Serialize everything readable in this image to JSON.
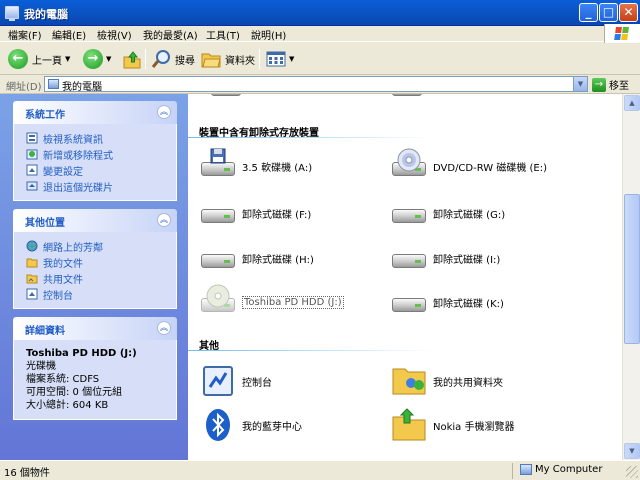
{
  "window": {
    "title": "我的電腦"
  },
  "menu": {
    "items": [
      "檔案(F)",
      "編輯(E)",
      "檢視(V)",
      "我的最愛(A)",
      "工具(T)",
      "說明(H)"
    ]
  },
  "toolbar": {
    "back_label": "上一頁",
    "search_label": "搜尋",
    "folders_label": "資料夾"
  },
  "address": {
    "label": "網址(D)",
    "value": "我的電腦",
    "go_label": "移至"
  },
  "system_tasks": {
    "title": "系統工作",
    "items": [
      "檢視系統資訊",
      "新增或移除程式",
      "變更設定",
      "退出這個光碟片"
    ]
  },
  "other_places": {
    "title": "其他位置",
    "items": [
      "網路上的芳鄰",
      "我的文件",
      "共用文件",
      "控制台"
    ]
  },
  "details": {
    "title": "詳細資料",
    "name": "Toshiba PD HDD (J:)",
    "type": "光碟機",
    "filesystem": "檔案系統: CDFS",
    "free": "可用空間: 0 個位元組",
    "total": "大小總計: 604 KB"
  },
  "removable": {
    "header": "裝置中含有卸除式存放裝置",
    "items": [
      "3.5 軟碟機 (A:)",
      "DVD/CD-RW 磁碟機 (E:)",
      "卸除式磁碟 (F:)",
      "卸除式磁碟 (G:)",
      "卸除式磁碟 (H:)",
      "卸除式磁碟 (I:)",
      "Toshiba PD HDD (J:)",
      "卸除式磁碟 (K:)"
    ]
  },
  "other": {
    "header": "其他",
    "items": [
      "控制台",
      "我的共用資料夾",
      "我的藍芽中心",
      "Nokia 手機瀏覽器"
    ]
  },
  "status": {
    "count": "16 個物件",
    "location": "My Computer"
  },
  "colors": {
    "title_bar": "#0b55c7",
    "task_pane": "#6f8fe0",
    "link_blue": "#215dc6"
  }
}
